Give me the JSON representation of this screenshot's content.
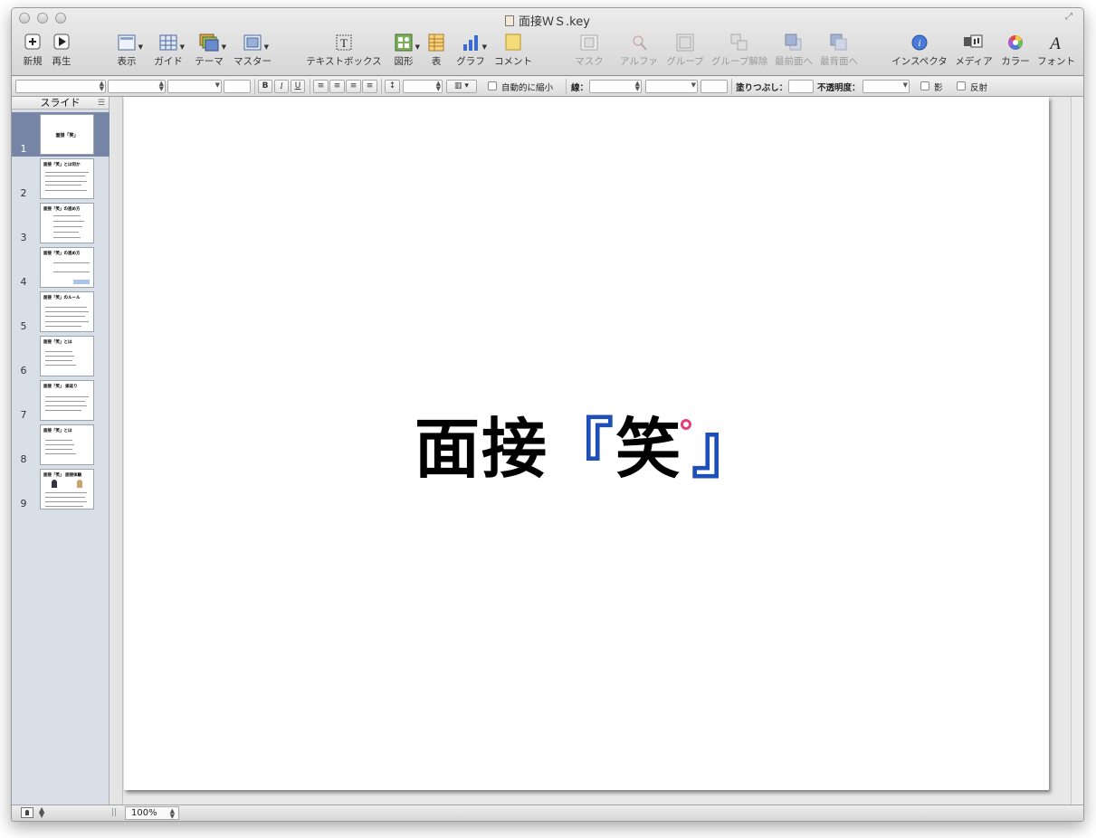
{
  "window": {
    "title": "面接ＷＳ.key"
  },
  "toolbar": {
    "items": [
      {
        "label": "新規",
        "icon": "plus-icon"
      },
      {
        "label": "再生",
        "icon": "play-icon"
      },
      {
        "label": "表示",
        "icon": "view-icon"
      },
      {
        "label": "ガイド",
        "icon": "guide-grid-icon"
      },
      {
        "label": "テーマ",
        "icon": "theme-icon"
      },
      {
        "label": "マスター",
        "icon": "master-icon"
      },
      {
        "label": "テキストボックス",
        "icon": "text-box-icon"
      },
      {
        "label": "図形",
        "icon": "shapes-icon"
      },
      {
        "label": "表",
        "icon": "table-icon"
      },
      {
        "label": "グラフ",
        "icon": "chart-icon"
      },
      {
        "label": "コメント",
        "icon": "comment-icon"
      },
      {
        "label": "マスク",
        "icon": "mask-icon"
      },
      {
        "label": "アルファ",
        "icon": "alpha-icon"
      },
      {
        "label": "グループ",
        "icon": "group-icon"
      },
      {
        "label": "グループ解除",
        "icon": "ungroup-icon"
      },
      {
        "label": "最前面へ",
        "icon": "bring-front-icon"
      },
      {
        "label": "最背面へ",
        "icon": "send-back-icon"
      },
      {
        "label": "インスペクタ",
        "icon": "inspector-icon"
      },
      {
        "label": "メディア",
        "icon": "media-icon"
      },
      {
        "label": "カラー",
        "icon": "color-wheel-icon"
      },
      {
        "label": "フォント",
        "icon": "font-icon"
      }
    ]
  },
  "formatbar": {
    "bold": "B",
    "italic": "I",
    "underline": "U",
    "auto_shrink_label": "自動的に縮小",
    "line_label": "線：",
    "fill_label": "塗りつぶし：",
    "opacity_label": "不透明度：",
    "shadow_label": "影",
    "reflection_label": "反射"
  },
  "navigator": {
    "header": "スライド",
    "slides": [
      {
        "number": "1",
        "title": "面接「笑」",
        "selected": true
      },
      {
        "number": "2",
        "title": "面接「笑」とは何か",
        "selected": false
      },
      {
        "number": "3",
        "title": "面接「笑」の進め方",
        "selected": false
      },
      {
        "number": "4",
        "title": "面接「笑」の進め方",
        "selected": false
      },
      {
        "number": "5",
        "title": "面接「笑」のルール",
        "selected": false
      },
      {
        "number": "6",
        "title": "面接「笑」とは",
        "selected": false
      },
      {
        "number": "7",
        "title": "面接「笑」 振返り",
        "selected": false
      },
      {
        "number": "8",
        "title": "面接「笑」とは",
        "selected": false
      },
      {
        "number": "9",
        "title": "面接「笑」 面接体験",
        "selected": false
      }
    ]
  },
  "slide": {
    "title_main": "面接",
    "bracket_open": "『",
    "title_char": "笑",
    "bracket_close": "』",
    "bracket_color": "#1d4fb7",
    "mark_color": "#e0407a"
  },
  "bottombar": {
    "zoom": "100%"
  }
}
